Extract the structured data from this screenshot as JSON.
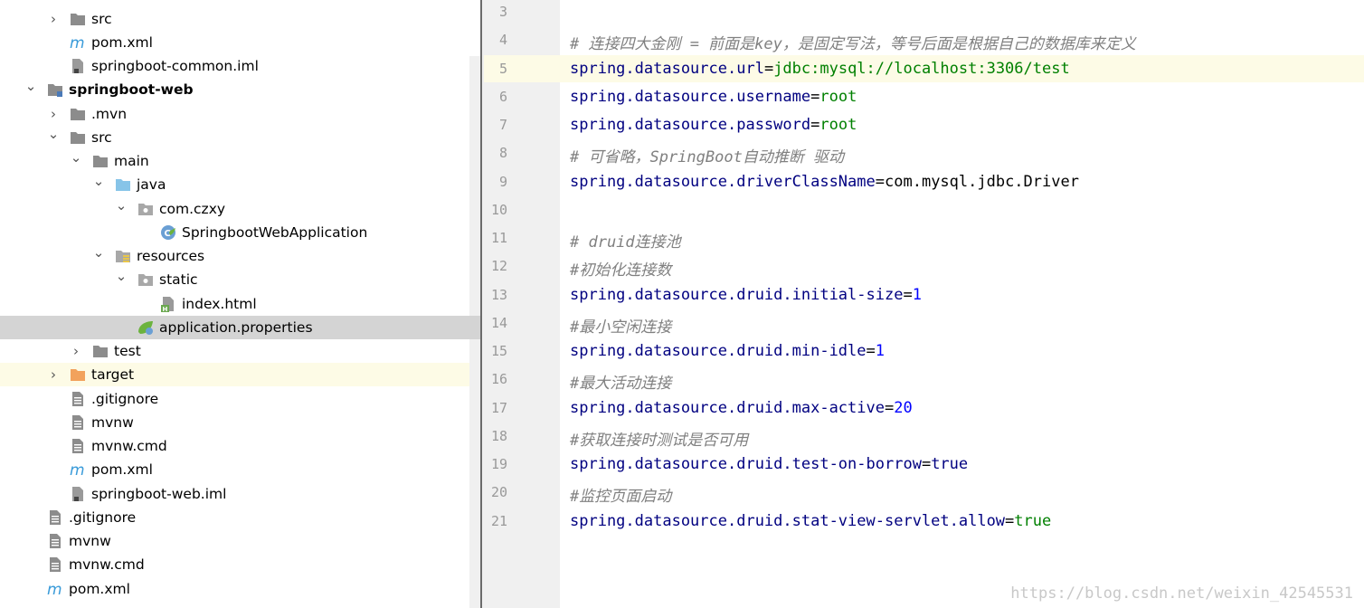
{
  "tree": [
    {
      "label": "src",
      "indent": 0,
      "arrow": "right",
      "icon": "folder"
    },
    {
      "label": "pom.xml",
      "indent": 0,
      "arrow": "",
      "icon": "maven"
    },
    {
      "label": "springboot-common.iml",
      "indent": 0,
      "arrow": "",
      "icon": "iml"
    },
    {
      "label": "springboot-web",
      "indent": -1,
      "arrow": "down",
      "icon": "module",
      "bold": true
    },
    {
      "label": ".mvn",
      "indent": 0,
      "arrow": "right",
      "icon": "folder"
    },
    {
      "label": "src",
      "indent": 0,
      "arrow": "down",
      "icon": "folder"
    },
    {
      "label": "main",
      "indent": 1,
      "arrow": "down",
      "icon": "folder"
    },
    {
      "label": "java",
      "indent": 2,
      "arrow": "down",
      "icon": "folder-blue"
    },
    {
      "label": "com.czxy",
      "indent": 3,
      "arrow": "down",
      "icon": "package"
    },
    {
      "label": "SpringbootWebApplication",
      "indent": 4,
      "arrow": "",
      "icon": "spring-class"
    },
    {
      "label": "resources",
      "indent": 2,
      "arrow": "down",
      "icon": "resources-folder"
    },
    {
      "label": "static",
      "indent": 3,
      "arrow": "down",
      "icon": "package"
    },
    {
      "label": "index.html",
      "indent": 4,
      "arrow": "",
      "icon": "html"
    },
    {
      "label": "application.properties",
      "indent": 3,
      "arrow": "",
      "icon": "spring-leaf",
      "selected": true
    },
    {
      "label": "test",
      "indent": 1,
      "arrow": "right",
      "icon": "folder"
    },
    {
      "label": "target",
      "indent": 0,
      "arrow": "right",
      "icon": "folder-orange",
      "highlight": true
    },
    {
      "label": ".gitignore",
      "indent": 0,
      "arrow": "",
      "icon": "file"
    },
    {
      "label": "mvnw",
      "indent": 0,
      "arrow": "",
      "icon": "file"
    },
    {
      "label": "mvnw.cmd",
      "indent": 0,
      "arrow": "",
      "icon": "file"
    },
    {
      "label": "pom.xml",
      "indent": 0,
      "arrow": "",
      "icon": "maven"
    },
    {
      "label": "springboot-web.iml",
      "indent": 0,
      "arrow": "",
      "icon": "iml"
    },
    {
      "label": ".gitignore",
      "indent": -1,
      "arrow": "",
      "icon": "file"
    },
    {
      "label": "mvnw",
      "indent": -1,
      "arrow": "",
      "icon": "file"
    },
    {
      "label": "mvnw.cmd",
      "indent": -1,
      "arrow": "",
      "icon": "file"
    },
    {
      "label": "pom.xml",
      "indent": -1,
      "arrow": "",
      "icon": "maven"
    }
  ],
  "editor": {
    "current_line": 5,
    "lines": [
      {
        "n": "3",
        "parts": []
      },
      {
        "n": "4",
        "parts": [
          {
            "t": "c",
            "s": "# 连接四大金刚 = 前面是key，是固定写法，等号后面是根据自己的数据库来定义"
          }
        ]
      },
      {
        "n": "5",
        "parts": [
          {
            "t": "k",
            "s": "spring.datasource.url"
          },
          {
            "t": "eq",
            "s": "="
          },
          {
            "t": "v",
            "s": "jdbc:mysql://localhost:3306/test"
          }
        ]
      },
      {
        "n": "6",
        "parts": [
          {
            "t": "k",
            "s": "spring.datasource.username"
          },
          {
            "t": "eq",
            "s": "="
          },
          {
            "t": "v",
            "s": "root"
          }
        ]
      },
      {
        "n": "7",
        "parts": [
          {
            "t": "k",
            "s": "spring.datasource.password"
          },
          {
            "t": "eq",
            "s": "="
          },
          {
            "t": "v",
            "s": "root"
          }
        ]
      },
      {
        "n": "8",
        "parts": [
          {
            "t": "c",
            "s": "# 可省略，SpringBoot自动推断 驱动"
          }
        ]
      },
      {
        "n": "9",
        "parts": [
          {
            "t": "k",
            "s": "spring.datasource.driverClassName"
          },
          {
            "t": "eq",
            "s": "="
          },
          {
            "t": "eq",
            "s": "com.mysql.jdbc.Driver"
          }
        ]
      },
      {
        "n": "10",
        "parts": []
      },
      {
        "n": "11",
        "parts": [
          {
            "t": "c",
            "s": "# druid连接池"
          }
        ]
      },
      {
        "n": "12",
        "parts": [
          {
            "t": "c",
            "s": "#初始化连接数"
          }
        ]
      },
      {
        "n": "13",
        "parts": [
          {
            "t": "k",
            "s": "spring.datasource.druid.initial-size"
          },
          {
            "t": "eq",
            "s": "="
          },
          {
            "t": "n",
            "s": "1"
          }
        ]
      },
      {
        "n": "14",
        "parts": [
          {
            "t": "c",
            "s": "#最小空闲连接"
          }
        ]
      },
      {
        "n": "15",
        "parts": [
          {
            "t": "k",
            "s": "spring.datasource.druid.min-idle"
          },
          {
            "t": "eq",
            "s": "="
          },
          {
            "t": "n",
            "s": "1"
          }
        ]
      },
      {
        "n": "16",
        "parts": [
          {
            "t": "c",
            "s": "#最大活动连接"
          }
        ]
      },
      {
        "n": "17",
        "parts": [
          {
            "t": "k",
            "s": "spring.datasource.druid.max-active"
          },
          {
            "t": "eq",
            "s": "="
          },
          {
            "t": "n",
            "s": "20"
          }
        ]
      },
      {
        "n": "18",
        "parts": [
          {
            "t": "c",
            "s": "#获取连接时测试是否可用"
          }
        ]
      },
      {
        "n": "19",
        "parts": [
          {
            "t": "k",
            "s": "spring.datasource.druid.test-on-borrow"
          },
          {
            "t": "eq",
            "s": "="
          },
          {
            "t": "k",
            "s": "true"
          }
        ]
      },
      {
        "n": "20",
        "parts": [
          {
            "t": "c",
            "s": "#监控页面启动"
          }
        ]
      },
      {
        "n": "21",
        "parts": [
          {
            "t": "k",
            "s": "spring.datasource.druid.stat-view-servlet.allow"
          },
          {
            "t": "eq",
            "s": "="
          },
          {
            "t": "v",
            "s": "true"
          }
        ]
      }
    ]
  },
  "watermark": "https://blog.csdn.net/weixin_42545531",
  "colors": {
    "key": "#000080",
    "value": "#008000",
    "comment": "#808080",
    "number": "#0000ff",
    "current_line": "#fdfbe6",
    "selection": "#d4d4d4"
  }
}
